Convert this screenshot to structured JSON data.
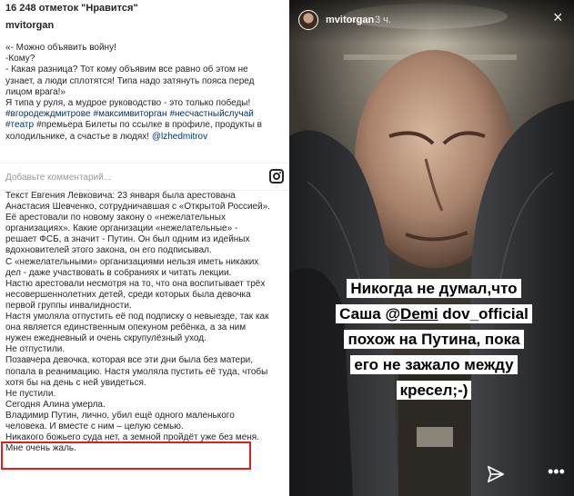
{
  "post": {
    "likes": "16 248 отметок \"Нравится\"",
    "username": "mvitorgan",
    "caption_lines": [
      "«- Можно объявить войну!",
      "-Кому?",
      "- Какая разница? Тот кому объявим все равно об этом не",
      "узнает, а люди сплотятся! Типа надо затянуть пояса перед",
      "лицом врага!»",
      "Я типа у руля, а мудрое руководство - это только победы!"
    ],
    "hashtags_line1": [
      "#вгородеждмитрове",
      "#максимвиторган",
      "#несчастныйслучай"
    ],
    "hashtag_line2": "#театр",
    "hashtag_line2_rest": "#премьера Билеты по ссылке в профиле, продукты в",
    "caption_line_after": "холодильнике, а счастье в людях!",
    "mention": "@lzhedmitrov"
  },
  "comment": {
    "placeholder": "Добавьте комментарий..."
  },
  "article": {
    "lines": [
      "Текст Евгения Левковича: 23 января была арестована",
      "Анастасия Шевченко, сотрудничавшая с «Открытой Россией».",
      "Её арестовали по новому закону о «нежелательных",
      "организациях». Какие организации «нежелательные» -",
      "решает ФСБ, а значит - Путин. Он был одним из идейных",
      "вдохновителей этого закона, он его подписывал.",
      "С «нежелательными» организациями нельзя иметь никаких",
      "дел - даже участвовать в собраниях и читать лекции.",
      "Настю арестовали несмотря на то, что она воспитывает трёх",
      "несовершеннолетних детей, среди которых была девочка",
      "первой группы инвалидности.",
      "Настя умоляла отпустить её под подписку о невыезде, так как",
      "она является единственным опекуном ребёнка, а за ним",
      "нужен ежедневный и очень скрупулёзный уход.",
      "Не отпустили.",
      "Позавчера девочка, которая все эти дни была без матери,",
      "попала в реанимацию. Настя умоляла пустить её туда, чтобы",
      "хотя бы на день с ней увидеться.",
      "Не пустили.",
      "Сегодня Алина умерла.",
      "Владимир Путин, лично, убил ещё одного маленького",
      "человека. И вместе с ним – целую семью.",
      "Никакого божьего суда нет, а земной пройдёт уже без меня.",
      "Мне очень жаль."
    ]
  },
  "story": {
    "username": "mvitorgan",
    "time": "3 ч.",
    "caption": {
      "line1": "Никогда не думал,что",
      "line2_pre": "Саша @",
      "line2_underlined": "Demi",
      "line2_post": " dov_official",
      "line3": "похож на Путина, пока",
      "line4": "его не зажало между",
      "line5": "кресел;-)"
    },
    "close_glyph": "×",
    "more_glyph": "•••"
  },
  "colors": {
    "highlight_border": "#e21d1d",
    "link": "#003569",
    "story_caption_bg": "#ffffff"
  }
}
